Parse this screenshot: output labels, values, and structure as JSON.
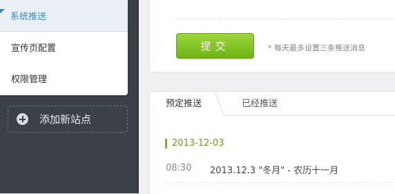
{
  "sidebar": {
    "menu": [
      {
        "label": "系统推送",
        "active": true
      },
      {
        "label": "宣传页配置",
        "active": false
      },
      {
        "label": "权限管理",
        "active": false
      }
    ],
    "add_site_label": "添加新站点",
    "accent_color": "#3a8ccd"
  },
  "form": {
    "submit_label": "提交",
    "hint": "* 每天最多设置三条推送消息",
    "button_color": "#7cbb1a"
  },
  "push_panel": {
    "tabs": [
      {
        "label": "预定推送",
        "active": true
      },
      {
        "label": "已经推送",
        "active": false
      }
    ],
    "date": "2013-12-03",
    "entries": [
      {
        "time": "08:30",
        "title": "2013.12.3 \"冬月\" - 农历十一月"
      }
    ]
  }
}
